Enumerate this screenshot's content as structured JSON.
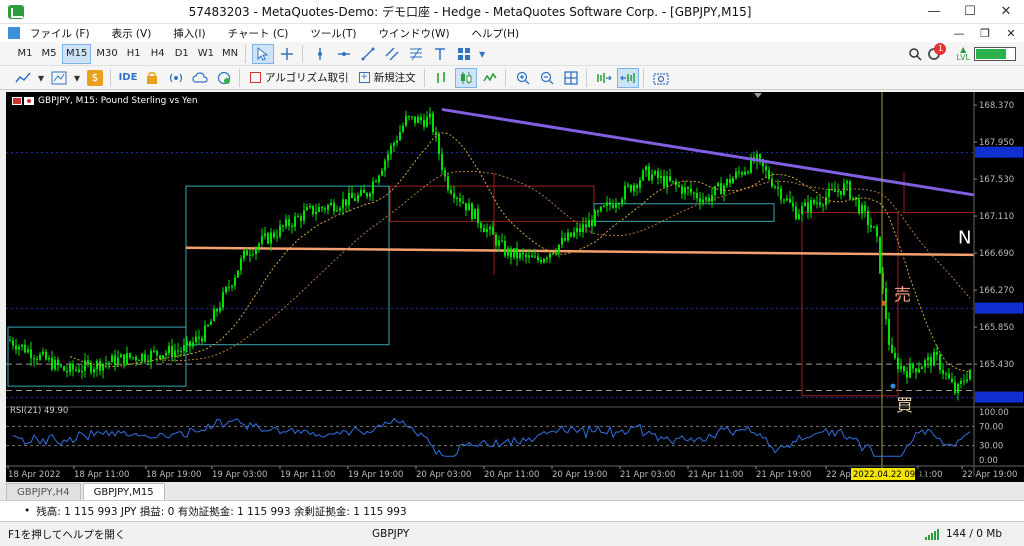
{
  "window": {
    "title": "57483203 - MetaQuotes-Demo: デモ口座 - Hedge - MetaQuotes Software Corp. - [GBPJPY,M15]",
    "minimize": "—",
    "maximize": "☐",
    "close": "✕"
  },
  "menu": {
    "items": [
      "ファイル (F)",
      "表示 (V)",
      "挿入(I)",
      "チャート (C)",
      "ツール(T)",
      "ウインドウ(W)",
      "ヘルプ(H)"
    ],
    "mdi_buttons": [
      "—",
      "❐",
      "✕"
    ]
  },
  "toolbar": {
    "timeframes": [
      "M1",
      "M5",
      "M15",
      "M30",
      "H1",
      "H4",
      "D1",
      "W1",
      "MN"
    ],
    "active_timeframe": "M15",
    "ide_label": "IDE",
    "dollar_label": "$",
    "algo_label": "アルゴリズム取引",
    "new_order_label": "新規注文",
    "notification_count": "1",
    "level_label": "LVL",
    "battery_level": 0.75,
    "accent_color": "#3173c3"
  },
  "chart": {
    "header": "GBPJPY, M15:  Pound Sterling vs Yen",
    "symbol": "GBPJPY",
    "timeframe": "M15",
    "price_labels": [
      "168.370",
      "167.950",
      "167.530",
      "167.110",
      "166.690",
      "166.270",
      "165.850",
      "165.430"
    ],
    "highlighted_prices": [
      "167.830",
      "166.060",
      "165.050"
    ],
    "rsi_label": "RSI(21) 49.90",
    "rsi_levels": [
      "100.00",
      "70.00",
      "30.00",
      "0.00"
    ],
    "time_labels": [
      "18 Apr 2022",
      "18 Apr 11:00",
      "18 Apr 19:00",
      "19 Apr 03:00",
      "19 Apr 11:00",
      "19 Apr 19:00",
      "20 Apr 03:00",
      "20 Apr 11:00",
      "20 Apr 19:00",
      "21 Apr 03:00",
      "21 Apr 11:00",
      "21 Apr 19:00",
      "22 Apr",
      "11:00",
      "22 Apr 19:00"
    ],
    "cursor_time": "2022.04.22 09:30",
    "sell_label": "売",
    "buy_label": "買",
    "edge_label": "N",
    "colors": {
      "background": "#000000",
      "candles": "#00e000",
      "trendline": "#8060e0",
      "support_line": "#f4a070",
      "rsi_line": "#3070e0",
      "highlight_price": "#1030d0"
    }
  },
  "tabs": [
    "GBPJPY,H4",
    "GBPJPY,M15"
  ],
  "active_tab": "GBPJPY,M15",
  "account": {
    "text": "残高: 1 115 993 JPY  損益: 0  有効証拠金: 1 115 993  余剰証拠金: 1 115 993"
  },
  "statusbar": {
    "help": "F1を押してヘルプを開く",
    "symbol": "GBPJPY",
    "traffic": "144 / 0 Mb"
  }
}
